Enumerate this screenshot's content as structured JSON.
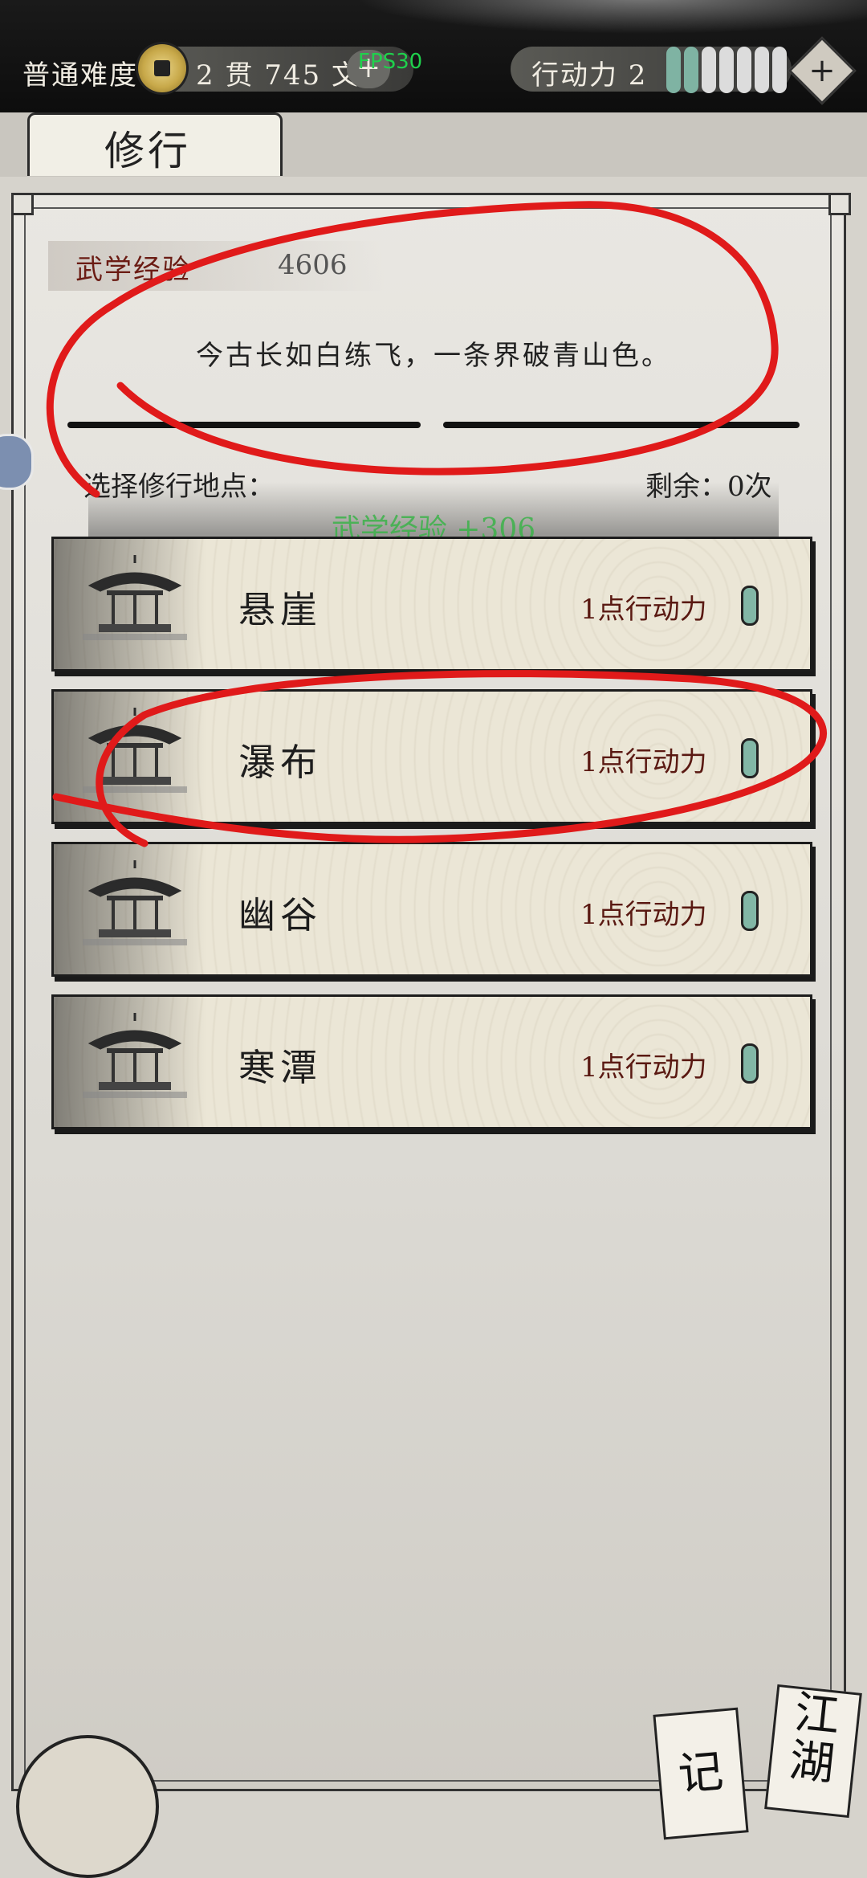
{
  "topbar": {
    "difficulty": "普通难度",
    "money": "2 贯  745  文",
    "money_plus": "+",
    "fps": "FPS30",
    "action_label": "行动力 2",
    "action_pips": [
      1,
      1,
      0,
      0,
      0,
      0,
      0
    ],
    "action_plus": "+"
  },
  "tab": {
    "label": "修行"
  },
  "panel": {
    "exp_label": "武学经验",
    "exp_value": "4606",
    "poem": "今古长如白练飞，一条界破青山色。",
    "choose_label": "选择修行地点：",
    "remain_label": "剩余：0次",
    "exp_gain": "武学经验 +306"
  },
  "locations": [
    {
      "name": "悬崖",
      "cost": "1点行动力"
    },
    {
      "name": "瀑布",
      "cost": "1点行动力"
    },
    {
      "name": "幽谷",
      "cost": "1点行动力"
    },
    {
      "name": "寒潭",
      "cost": "1点行动力"
    }
  ],
  "bottom": {
    "card_ji": "记",
    "card_jianghu": "江湖"
  },
  "colors": {
    "accent_green": "#7fb3a3",
    "annotation_red": "#e01a1a",
    "label_red": "#6b1c14"
  }
}
